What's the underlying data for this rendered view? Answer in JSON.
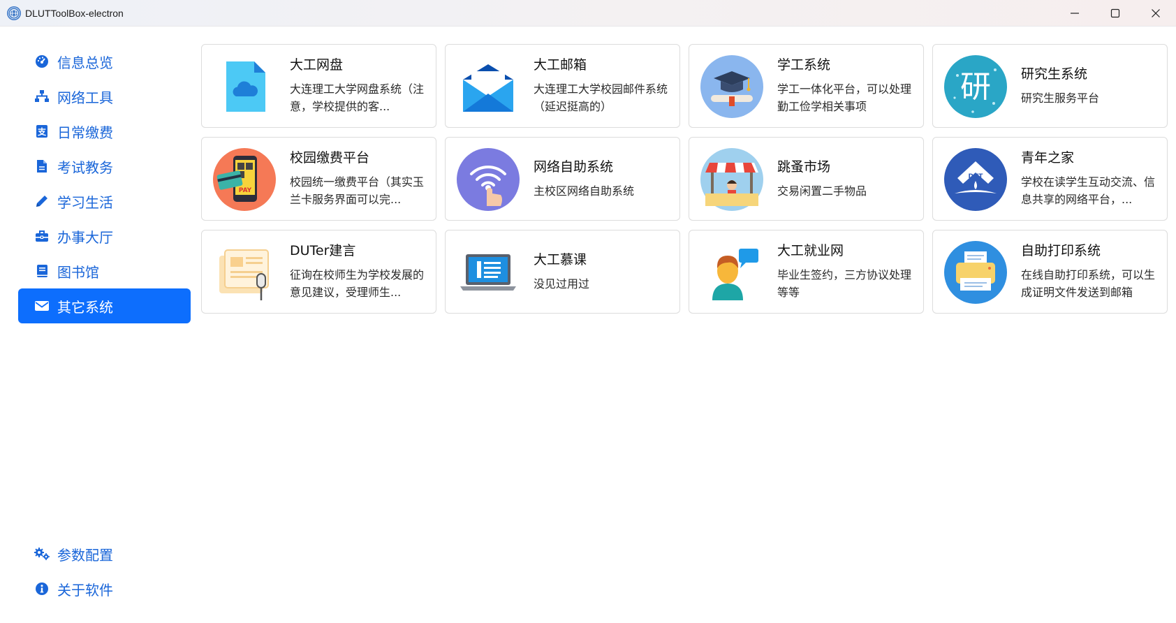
{
  "window": {
    "title": "DLUTToolBox-electron",
    "app_icon": "globe-logo-icon",
    "controls": [
      "minimize-icon",
      "maximize-icon",
      "close-icon"
    ]
  },
  "sidebar": {
    "accent": "#1a66d9",
    "active_bg": "#0d6efd",
    "items": [
      {
        "label": "信息总览",
        "icon": "dashboard-gauge-icon"
      },
      {
        "label": "网络工具",
        "icon": "network-icon"
      },
      {
        "label": "日常缴费",
        "icon": "payment-receipt-icon"
      },
      {
        "label": "考试教务",
        "icon": "document-icon"
      },
      {
        "label": "学习生活",
        "icon": "pencil-icon"
      },
      {
        "label": "办事大厅",
        "icon": "briefcase-icon"
      },
      {
        "label": "图书馆",
        "icon": "book-icon"
      },
      {
        "label": "其它系统",
        "icon": "envelope-icon",
        "active": true
      }
    ],
    "bottom_items": [
      {
        "label": "参数配置",
        "icon": "gears-icon"
      },
      {
        "label": "关于软件",
        "icon": "info-circle-icon"
      }
    ]
  },
  "cards": [
    {
      "name": "大工网盘",
      "desc": "大连理工大学网盘系统（注意，学校提供的客...",
      "icon": "cloud-file-icon"
    },
    {
      "name": "大工邮箱",
      "desc": "大连理工大学校园邮件系统（延迟挺高的）",
      "icon": "mail-envelope-icon"
    },
    {
      "name": "学工系统",
      "desc": "学工一体化平台，可以处理勤工俭学相关事项",
      "icon": "graduation-cap-icon"
    },
    {
      "name": "研究生系统",
      "desc": "研究生服务平台",
      "icon": "graduate-badge-icon",
      "badge_text": "研"
    },
    {
      "name": "校园缴费平台",
      "desc": "校园统一缴费平台（其实玉兰卡服务界面可以完...",
      "icon": "mobile-pay-icon",
      "badge_text": "PAY"
    },
    {
      "name": "网络自助系统",
      "desc": "主校区网络自助系统",
      "icon": "wifi-touch-icon"
    },
    {
      "name": "跳蚤市场",
      "desc": "交易闲置二手物品",
      "icon": "market-stall-icon"
    },
    {
      "name": "青年之家",
      "desc": "学校在读学生互动交流、信息共享的网络平台，...",
      "icon": "dut-youth-logo-icon",
      "badge_text": "DUT"
    },
    {
      "name": "DUTer建言",
      "desc": "征询在校师生为学校发展的意见建议，受理师生...",
      "icon": "newspaper-microphone-icon"
    },
    {
      "name": "大工慕课",
      "desc": "没见过用过",
      "icon": "laptop-icon"
    },
    {
      "name": "大工就业网",
      "desc": "毕业生签约，三方协议处理等等",
      "icon": "person-chat-icon"
    },
    {
      "name": "自助打印系统",
      "desc": "在线自助打印系统，可以生成证明文件发送到邮箱",
      "icon": "printer-icon"
    }
  ]
}
